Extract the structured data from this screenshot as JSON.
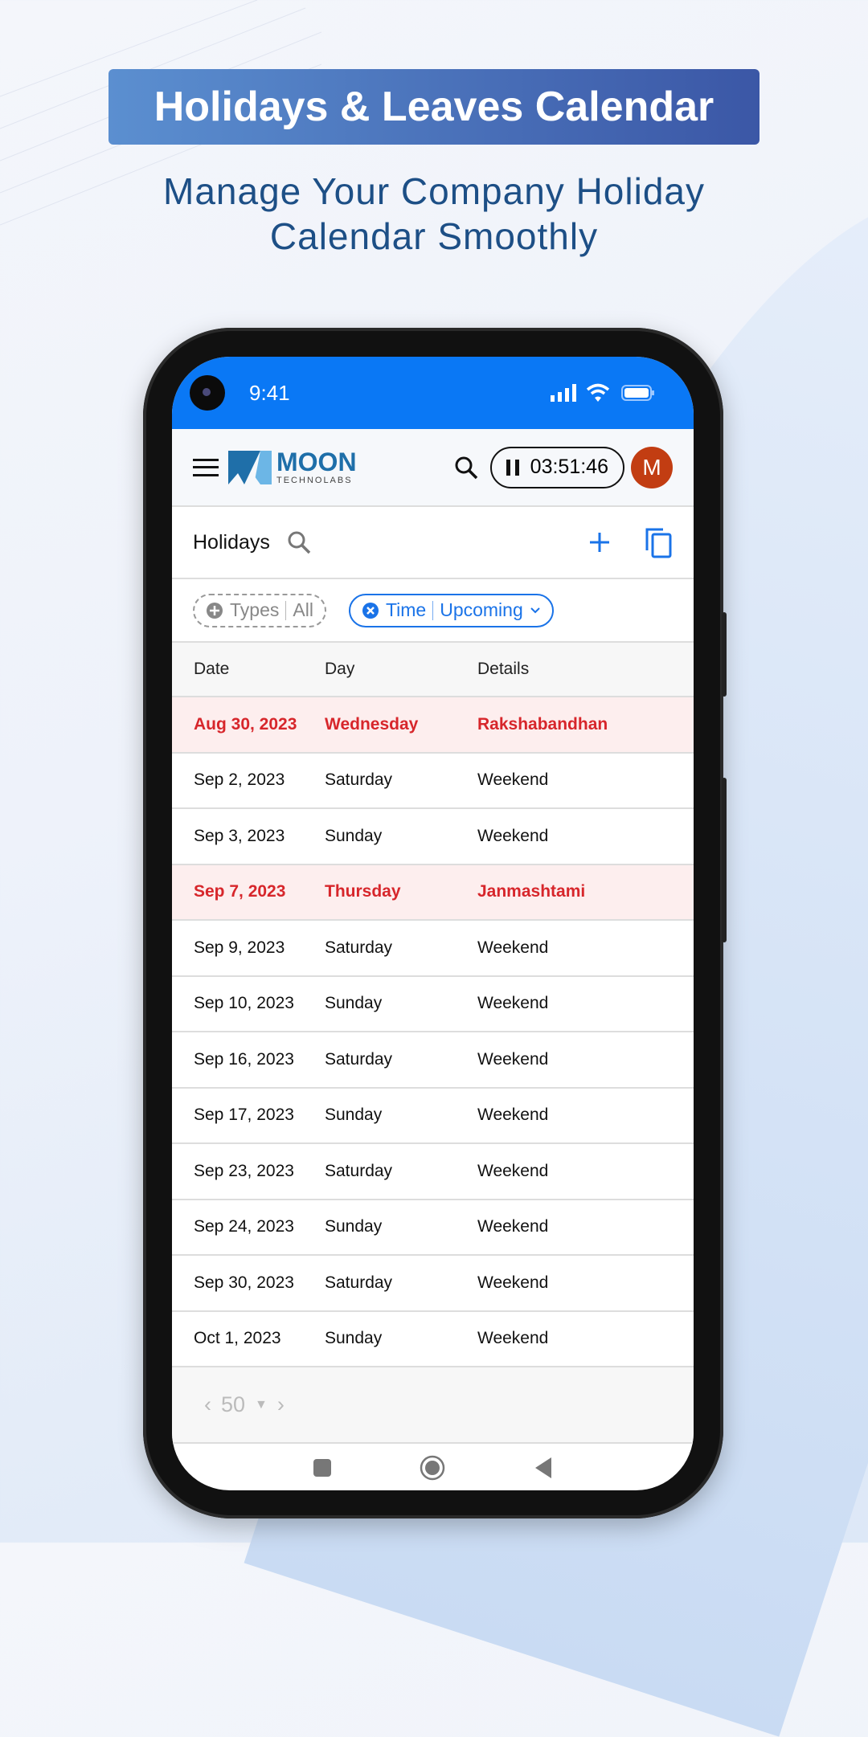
{
  "promo": {
    "title": "Holidays & Leaves Calendar",
    "subtitle_line1": "Manage Your Company Holiday",
    "subtitle_line2": "Calendar Smoothly"
  },
  "status_bar": {
    "time": "9:41",
    "icons": [
      "signal-icon",
      "wifi-icon",
      "battery-icon"
    ]
  },
  "app_bar": {
    "logo_main": "MOON",
    "logo_sub": "TECHNOLABS",
    "timer": "03:51:46",
    "avatar_initial": "M",
    "avatar_color": "#c23d12"
  },
  "page": {
    "title": "Holidays"
  },
  "filters": {
    "types_label": "Types",
    "types_value": "All",
    "time_label": "Time",
    "time_value": "Upcoming"
  },
  "table": {
    "headers": [
      "Date",
      "Day",
      "Details"
    ],
    "rows": [
      {
        "date": "Aug 30, 2023",
        "day": "Wednesday",
        "details": "Rakshabandhan",
        "holiday": true
      },
      {
        "date": "Sep 2, 2023",
        "day": "Saturday",
        "details": "Weekend",
        "holiday": false
      },
      {
        "date": "Sep 3, 2023",
        "day": "Sunday",
        "details": "Weekend",
        "holiday": false
      },
      {
        "date": "Sep 7, 2023",
        "day": "Thursday",
        "details": "Janmashtami",
        "holiday": true
      },
      {
        "date": "Sep 9, 2023",
        "day": "Saturday",
        "details": "Weekend",
        "holiday": false
      },
      {
        "date": "Sep 10, 2023",
        "day": "Sunday",
        "details": "Weekend",
        "holiday": false
      },
      {
        "date": "Sep 16, 2023",
        "day": "Saturday",
        "details": "Weekend",
        "holiday": false
      },
      {
        "date": "Sep 17, 2023",
        "day": "Sunday",
        "details": "Weekend",
        "holiday": false
      },
      {
        "date": "Sep 23, 2023",
        "day": "Saturday",
        "details": "Weekend",
        "holiday": false
      },
      {
        "date": "Sep 24, 2023",
        "day": "Sunday",
        "details": "Weekend",
        "holiday": false
      },
      {
        "date": "Sep 30, 2023",
        "day": "Saturday",
        "details": "Weekend",
        "holiday": false
      },
      {
        "date": "Oct 1, 2023",
        "day": "Sunday",
        "details": "Weekend",
        "holiday": false
      }
    ]
  },
  "pager": {
    "page_size": "50"
  },
  "colors": {
    "status_bar": "#0a78f5",
    "accent": "#1a73e8",
    "holiday_text": "#d7262b",
    "holiday_bg": "#fdeeee"
  }
}
